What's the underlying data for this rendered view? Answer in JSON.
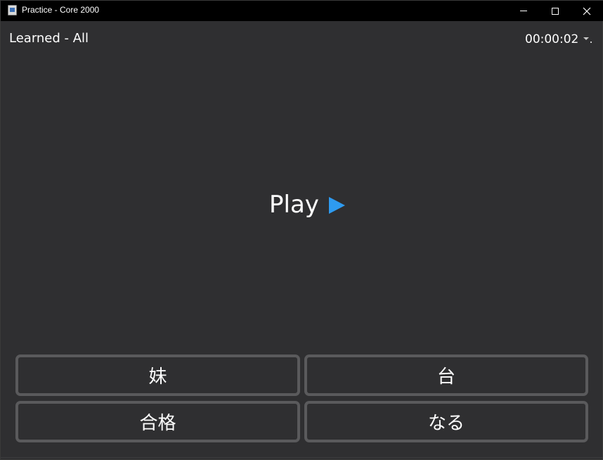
{
  "window": {
    "title": "Practice - Core 2000"
  },
  "header": {
    "deck_label": "Learned - All",
    "timer": "00:00:02"
  },
  "main": {
    "play_label": "Play",
    "play_icon": "play-triangle-icon",
    "accent_color": "#2e9bf0"
  },
  "answers": [
    {
      "label": "妹"
    },
    {
      "label": "台"
    },
    {
      "label": "合格"
    },
    {
      "label": "なる"
    }
  ]
}
